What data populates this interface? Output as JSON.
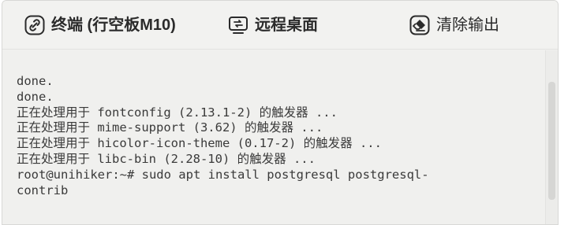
{
  "toolbar": {
    "terminal_label": "终端 (行空板M10)",
    "remote_label": "远程桌面",
    "clear_label": "清除输出"
  },
  "icons": {
    "terminal": "link-icon",
    "remote": "remote-desktop-icon",
    "clear": "eraser-icon"
  },
  "terminal": {
    "lines": [
      "done.",
      "done.",
      "正在处理用于 fontconfig (2.13.1-2) 的触发器 ...",
      "正在处理用于 mime-support (3.62) 的触发器 ...",
      "正在处理用于 hicolor-icon-theme (0.17-2) 的触发器 ...",
      "正在处理用于 libc-bin (2.28-10) 的触发器 ...",
      "root@unihiker:~# sudo apt install postgresql postgresql-",
      "contrib"
    ]
  },
  "colors": {
    "background": "#f0f0ee",
    "text": "#3a3a3a",
    "toolbar_text": "#2b2b2b"
  }
}
